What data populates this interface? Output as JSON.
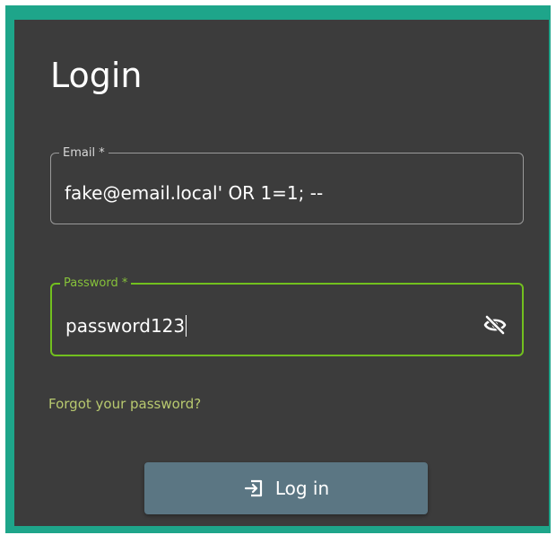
{
  "colors": {
    "frame_border": "#1ea58a",
    "panel_background": "#3c3c3c",
    "password_focus_border": "#72c01e",
    "link_color": "#b8c96f",
    "button_background": "#5b7683"
  },
  "login": {
    "title": "Login",
    "email": {
      "label": "Email *",
      "value": "fake@email.local' OR 1=1; --"
    },
    "password": {
      "label": "Password *",
      "value": "password123",
      "toggle_icon": "eye-off-icon",
      "focused": true
    },
    "forgot_link": "Forgot your password?",
    "submit": {
      "label": "Log in",
      "icon": "login-icon"
    }
  }
}
